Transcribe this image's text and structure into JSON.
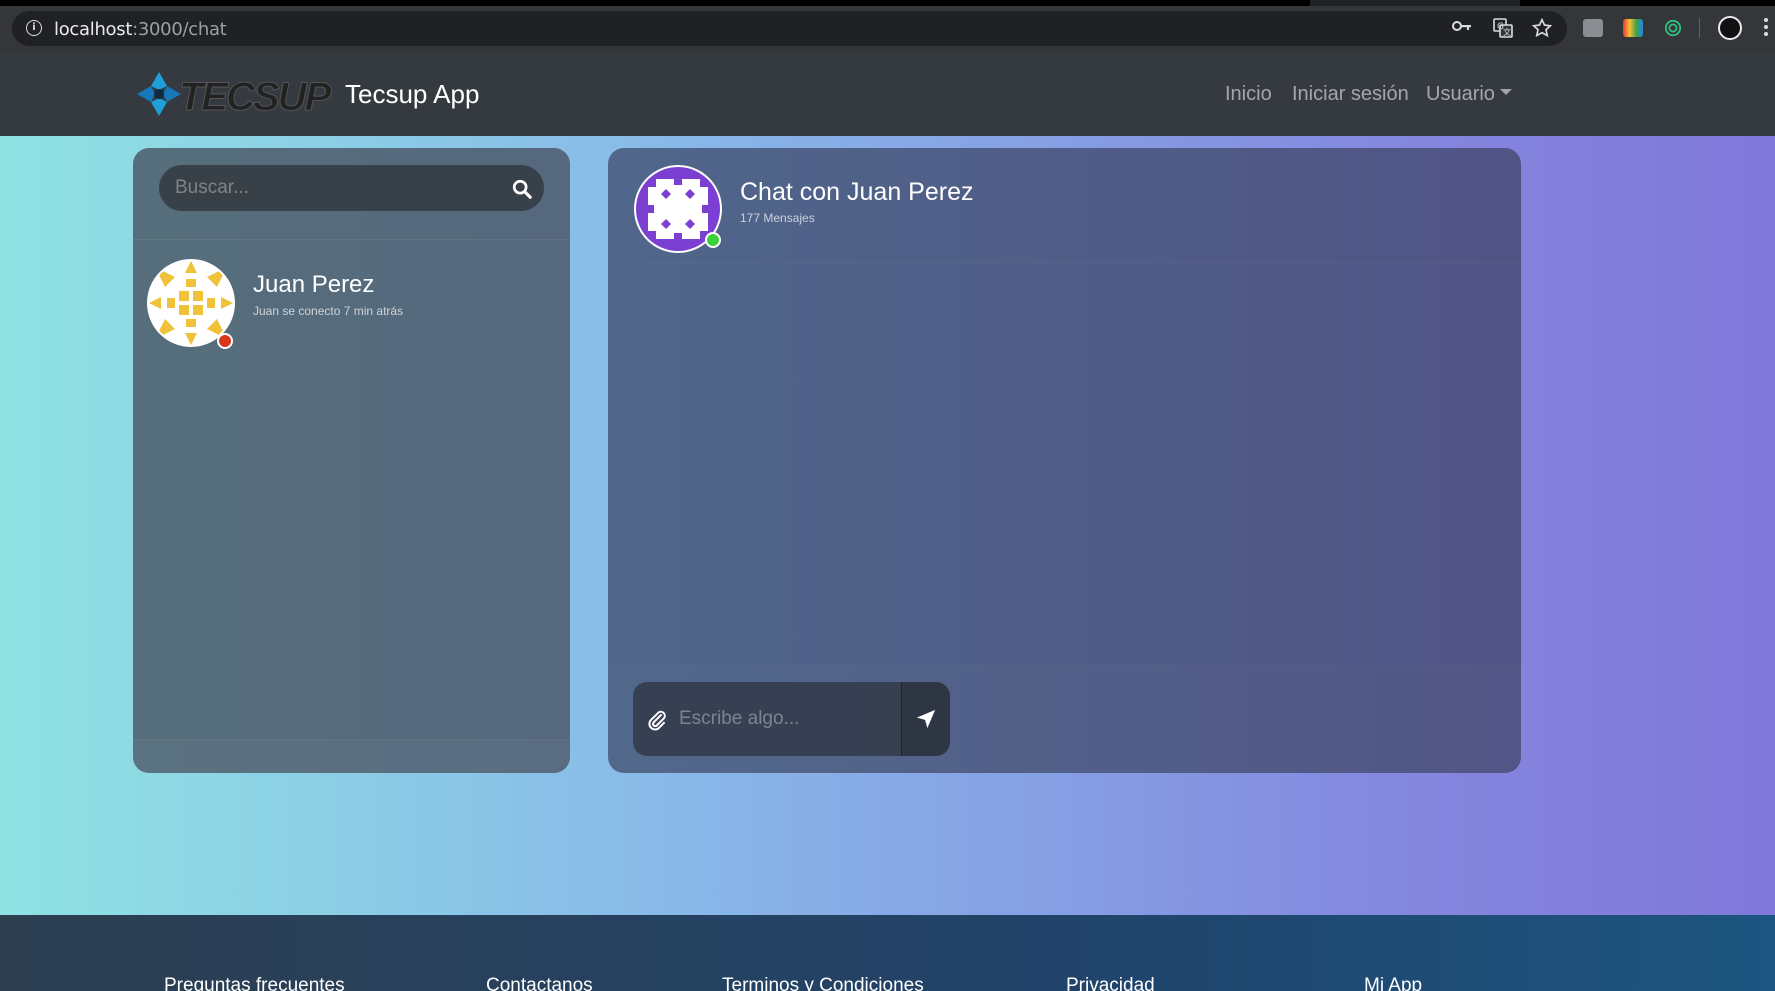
{
  "browser": {
    "url_host": "localhost",
    "url_path": ":3000/chat",
    "icons": [
      "info-icon",
      "key-icon",
      "translate-icon",
      "star-icon",
      "extension-icon",
      "color-extension-icon",
      "target-extension-icon",
      "profile-avatar",
      "menu-kebab-icon"
    ]
  },
  "navbar": {
    "logo_text": "TECSUP",
    "brand": "Tecsup App",
    "links": [
      "Inicio",
      "Iniciar sesión",
      "Usuario"
    ]
  },
  "sidebar": {
    "search_placeholder": "Buscar...",
    "contacts": [
      {
        "name": "Juan Perez",
        "status_text": "Juan se conecto 7 min atrás",
        "status_color": "#d9371c"
      }
    ]
  },
  "chat": {
    "title": "Chat con Juan Perez",
    "message_count": "177 Mensajes",
    "online_color": "#3ad13a",
    "input_placeholder": "Escribe algo..."
  },
  "footer": {
    "links": [
      "Preguntas frecuentes",
      "Contactanos",
      "Terminos y Condiciones",
      "Privacidad",
      "Mi App"
    ]
  },
  "colors": {
    "navbar_bg": "#343a40",
    "gradient_start": "#8fe3e3",
    "gradient_end": "#8078d9",
    "chat_avatar": "#7b3fd1",
    "contact_avatar": "#f0c23a"
  }
}
